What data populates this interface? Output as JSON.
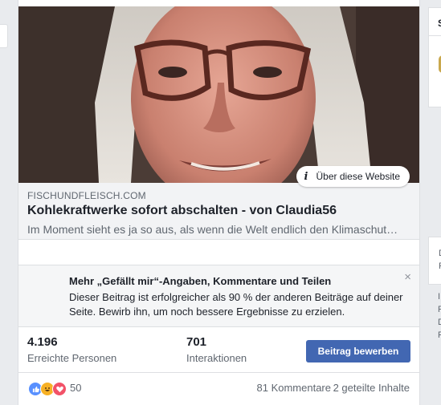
{
  "post": {
    "about_label": "Über diese Website",
    "about_icon": "info-icon",
    "link": {
      "domain": "FISCHUNDFLEISCH.COM",
      "title": "Kohlekraftwerke sofort abschalten - von Claudia56",
      "description": "Im Moment sieht es ja so aus, als wenn die Welt endlich den Klimaschut…"
    },
    "promo": {
      "title": "Mehr „Gefällt mir“-Angaben, Kommentare und Teilen",
      "body": "Dieser Beitrag ist erfolgreicher als 90 % der anderen Beiträge auf deiner Seite. Bewirb ihn, um noch bessere Ergebnisse zu erzielen.",
      "close": "×"
    },
    "stats": {
      "reach_value": "4.196",
      "reach_label": "Erreichte Personen",
      "engagement_value": "701",
      "engagement_label": "Interaktionen",
      "boost_label": "Beitrag bewerben"
    },
    "reactions": {
      "icons": [
        "like-icon",
        "haha-icon",
        "love-icon"
      ],
      "count": "50",
      "comments": "81 Kommentare",
      "shares": "2 geteilte Inhalte"
    }
  },
  "right_column": {
    "header_initial": "S",
    "letters": [
      "D",
      "F",
      "I",
      "F",
      "D",
      "F"
    ]
  },
  "colors": {
    "primary": "#4267b2",
    "like": "#5890ff",
    "haha": "#f7b125",
    "love": "#f25268",
    "page_bg": "#e9ebee"
  }
}
